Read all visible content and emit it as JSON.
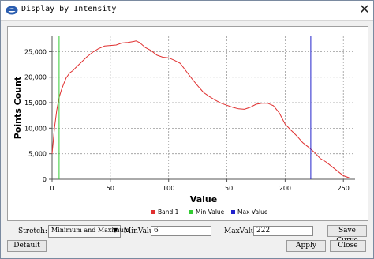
{
  "window": {
    "title": "Display by Intensity",
    "close_glyph": "✕"
  },
  "chart_data": {
    "type": "line",
    "xlabel": "Value",
    "ylabel": "Points Count",
    "xlim": [
      0,
      260
    ],
    "ylim": [
      0,
      28000
    ],
    "x_ticks": [
      0,
      50,
      100,
      150,
      200,
      250
    ],
    "y_ticks": [
      0,
      5000,
      10000,
      15000,
      20000,
      25000
    ],
    "x_tick_labels": [
      "0",
      "50",
      "100",
      "150",
      "200",
      "250"
    ],
    "y_tick_labels": [
      "0",
      "5,000",
      "10,000",
      "15,000",
      "20,000",
      "25,000"
    ],
    "grid": true,
    "legend_position": "bottom",
    "series": [
      {
        "name": "Band 1",
        "color": "#e03030",
        "x": [
          0,
          2,
          4,
          6,
          8,
          10,
          12,
          15,
          18,
          20,
          25,
          30,
          35,
          40,
          45,
          50,
          55,
          60,
          65,
          70,
          72,
          75,
          80,
          85,
          90,
          95,
          100,
          105,
          110,
          115,
          120,
          125,
          130,
          135,
          140,
          145,
          150,
          155,
          160,
          165,
          170,
          175,
          180,
          185,
          190,
          195,
          200,
          205,
          210,
          215,
          220,
          225,
          230,
          235,
          240,
          245,
          250,
          255
        ],
        "y": [
          5000,
          10000,
          13500,
          16000,
          17500,
          18700,
          19800,
          20800,
          21300,
          21800,
          22900,
          24000,
          24900,
          25600,
          26100,
          26200,
          26300,
          26700,
          26800,
          27000,
          27100,
          26800,
          25800,
          25200,
          24300,
          23900,
          23800,
          23300,
          22700,
          21200,
          19700,
          18300,
          17000,
          16200,
          15500,
          14900,
          14500,
          14100,
          13800,
          13700,
          14100,
          14700,
          14900,
          14900,
          14400,
          13000,
          10800,
          9600,
          8500,
          7200,
          6300,
          5300,
          4100,
          3400,
          2500,
          1600,
          700,
          300
        ]
      },
      {
        "name": "Min Value",
        "color": "#33cc33",
        "x": [
          6,
          6
        ],
        "y": [
          0,
          28000
        ]
      },
      {
        "name": "Max Value",
        "color": "#2222cc",
        "x": [
          222,
          222
        ],
        "y": [
          0,
          28000
        ]
      }
    ]
  },
  "controls": {
    "stretch_label": "Stretch:",
    "stretch_value": "Minimum and Maximum",
    "min_label": "MinValue",
    "min_value": "6",
    "max_label": "MaxValue",
    "max_value": "222",
    "save_curve": "Save Curve",
    "default": "Default",
    "apply": "Apply",
    "close": "Close"
  },
  "icons": {
    "app": "app-logo-icon",
    "dropdown": "dropdown-arrow-icon"
  }
}
